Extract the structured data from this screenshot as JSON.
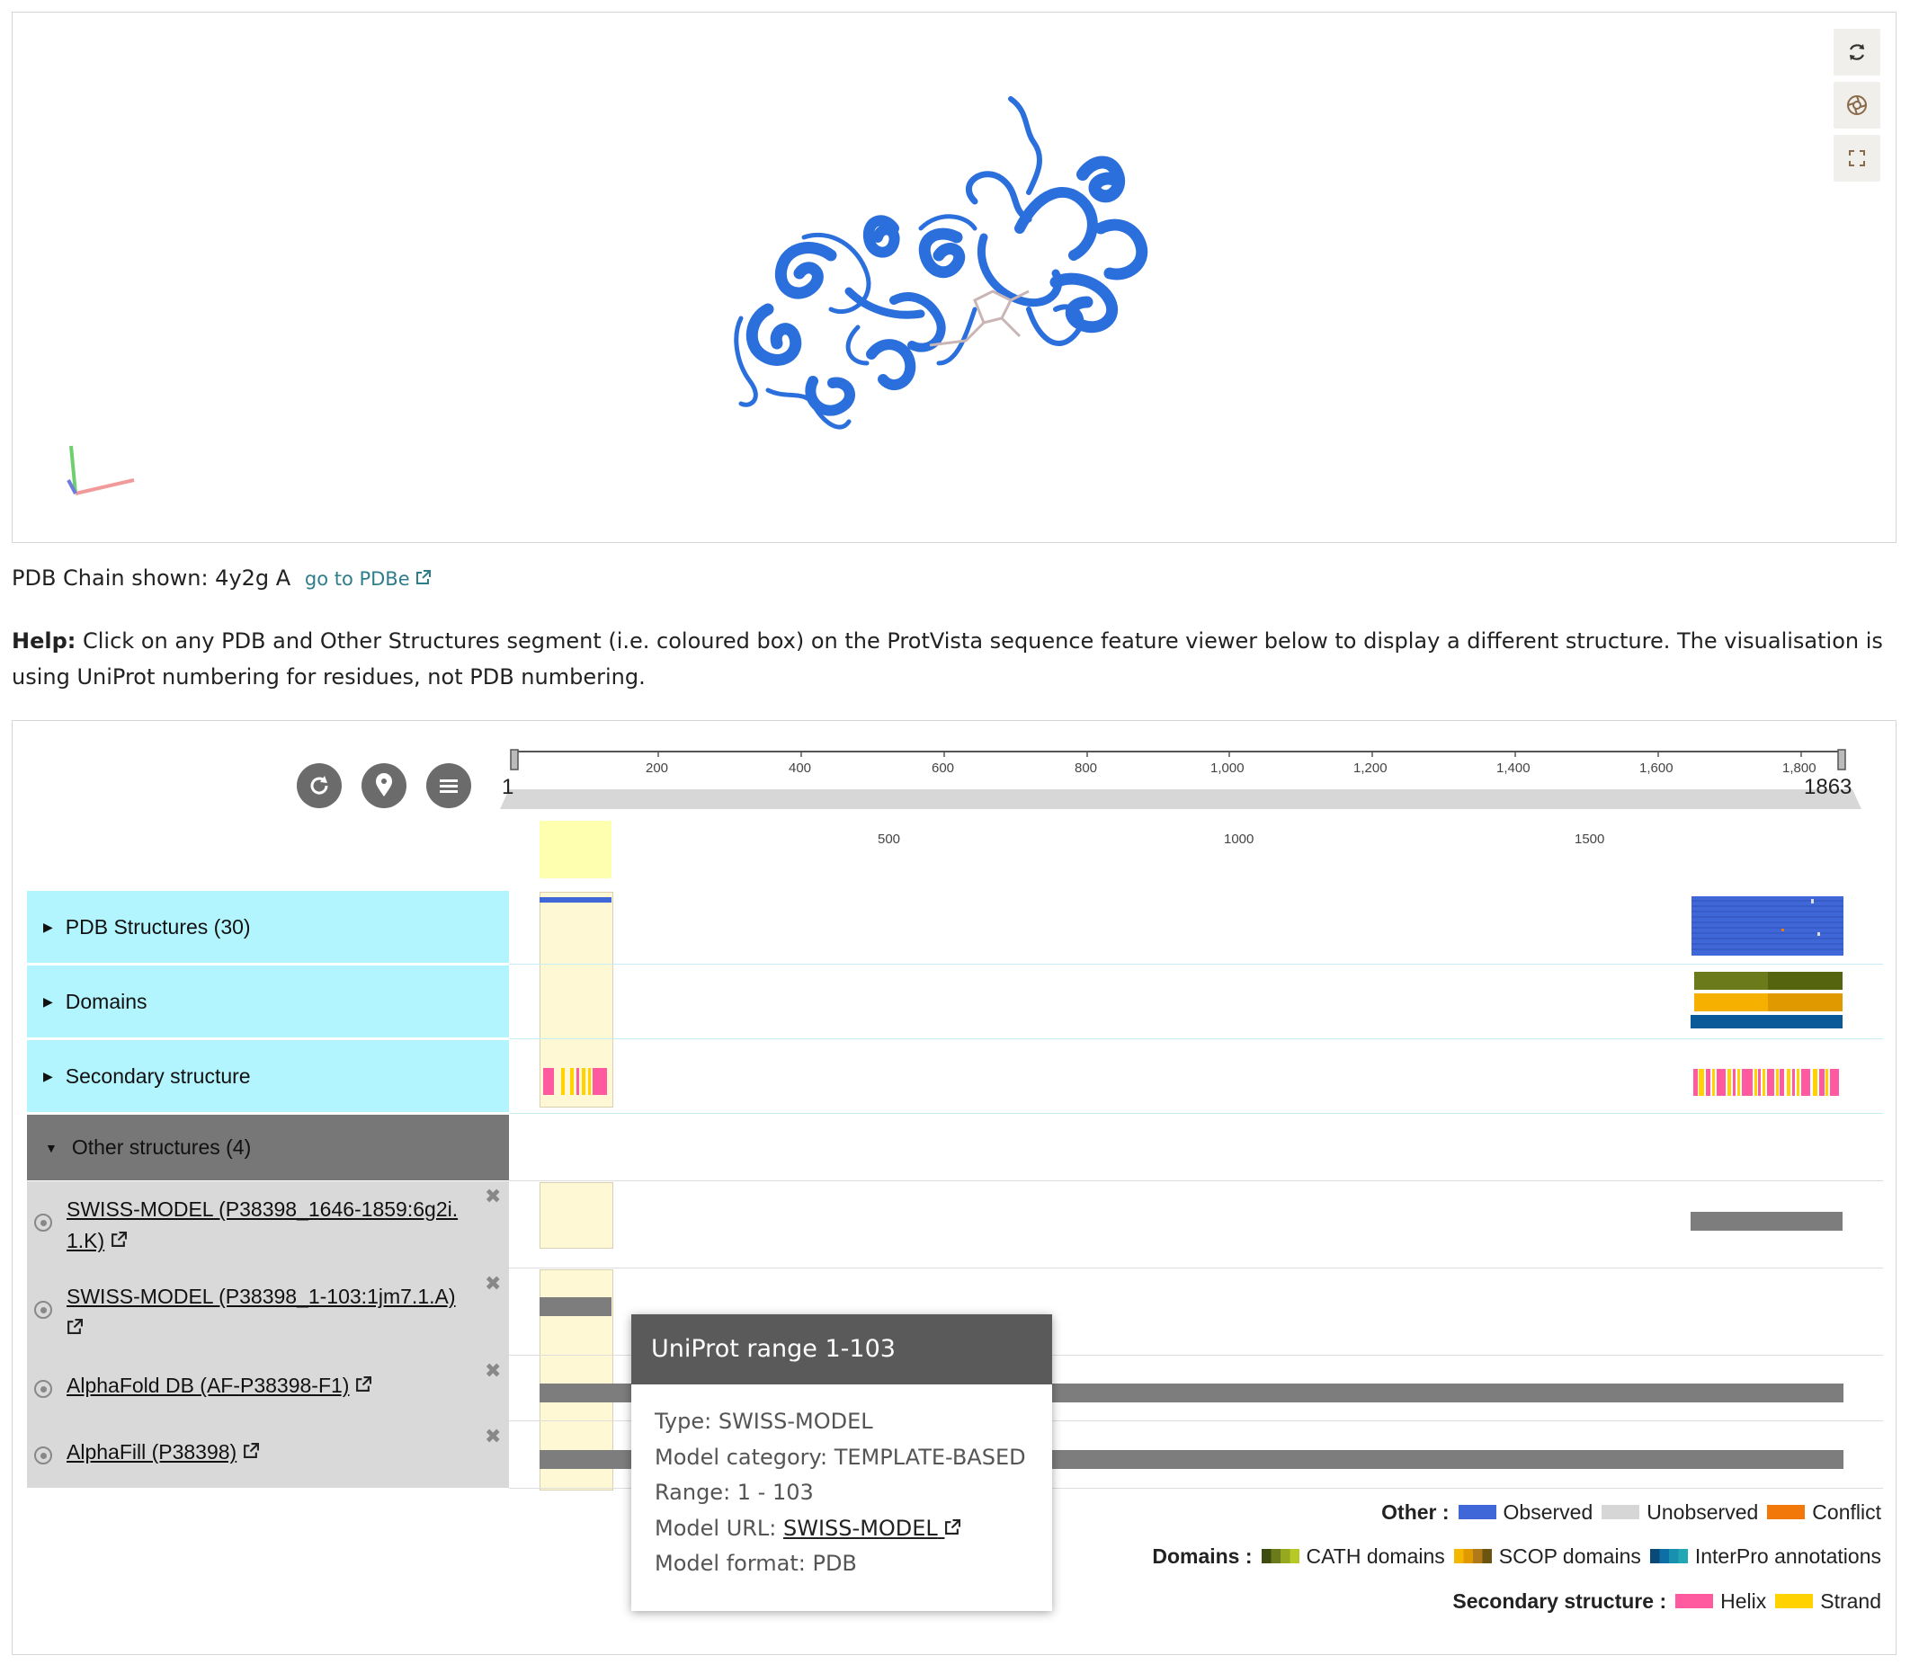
{
  "viewer": {
    "buttons": [
      {
        "name": "reset-view-icon",
        "glyph": "⟳"
      },
      {
        "name": "screenshot-icon",
        "glyph": "◎"
      },
      {
        "name": "fullscreen-icon",
        "glyph": "⛶"
      }
    ],
    "colors": {
      "cartoon": "#2a6fdb",
      "ligand": "#c9b5b5"
    }
  },
  "chain": {
    "label": "PDB Chain shown: 4y2g A",
    "link": "go to PDBe"
  },
  "help": {
    "bold": "Help:",
    "text": " Click on any PDB and Other Structures segment (i.e. coloured box) on the ProtVista sequence feature viewer below to display a different structure. The visualisation is using UniProt numbering for residues, not PDB numbering."
  },
  "protvista": {
    "buttons": [
      {
        "name": "reset-button",
        "glyph": "↻"
      },
      {
        "name": "location-button",
        "glyph": "⬤"
      },
      {
        "name": "menu-button",
        "glyph": "≡"
      }
    ],
    "ruler": {
      "start": "1",
      "end": "1863",
      "ticks": [
        "200",
        "400",
        "600",
        "800",
        "1,000",
        "1,200",
        "1,400",
        "1,600",
        "1,800"
      ]
    },
    "overview_ticks": [
      "500",
      "1000",
      "1500"
    ],
    "tracks": [
      {
        "label": "PDB Structures (30)"
      },
      {
        "label": "Domains"
      },
      {
        "label": "Secondary structure"
      }
    ],
    "other": {
      "header": "Other structures (4)",
      "items": [
        {
          "label": "SWISS-MODEL (P38398_1646-1859:6g2i.",
          "label2": "1.K)"
        },
        {
          "label": "SWISS-MODEL (P38398_1-103:1jm7.1.A)",
          "label2": ""
        },
        {
          "label": "AlphaFold DB (AF-P38398-F1)",
          "label2": ""
        },
        {
          "label": "AlphaFill (P38398)",
          "label2": ""
        }
      ]
    },
    "legend": {
      "other": {
        "title": "Other :",
        "items": [
          {
            "label": "Observed",
            "color": "#3f67d8"
          },
          {
            "label": "Unobserved",
            "color": "#d6d6d6"
          },
          {
            "label": "Conflict",
            "color": "#f2780a"
          }
        ]
      },
      "domains": {
        "title": "Domains :",
        "items": [
          {
            "label": "CATH domains",
            "colors": [
              "#3d4d10",
              "#6b7a1a",
              "#95a81e",
              "#b7c924"
            ]
          },
          {
            "label": "SCOP domains",
            "colors": [
              "#f5b800",
              "#e09a00",
              "#b07a1a",
              "#6b5310"
            ]
          },
          {
            "label": "InterPro annotations",
            "colors": [
              "#0a4a78",
              "#0e6ea6",
              "#1a90b0",
              "#22a7b5"
            ]
          }
        ]
      },
      "secondary": {
        "title": "Secondary structure :",
        "items": [
          {
            "label": "Helix",
            "color": "#ff5aa0"
          },
          {
            "label": "Strand",
            "color": "#ffd200"
          }
        ]
      }
    }
  },
  "tooltip": {
    "title": "UniProt range 1-103",
    "type": "Type: SWISS-MODEL",
    "category": "Model category: TEMPLATE-BASED",
    "range": "Range: 1 - 103",
    "url_label": "Model URL: ",
    "url_link": "SWISS-MODEL",
    "format": "Model format: PDB"
  }
}
